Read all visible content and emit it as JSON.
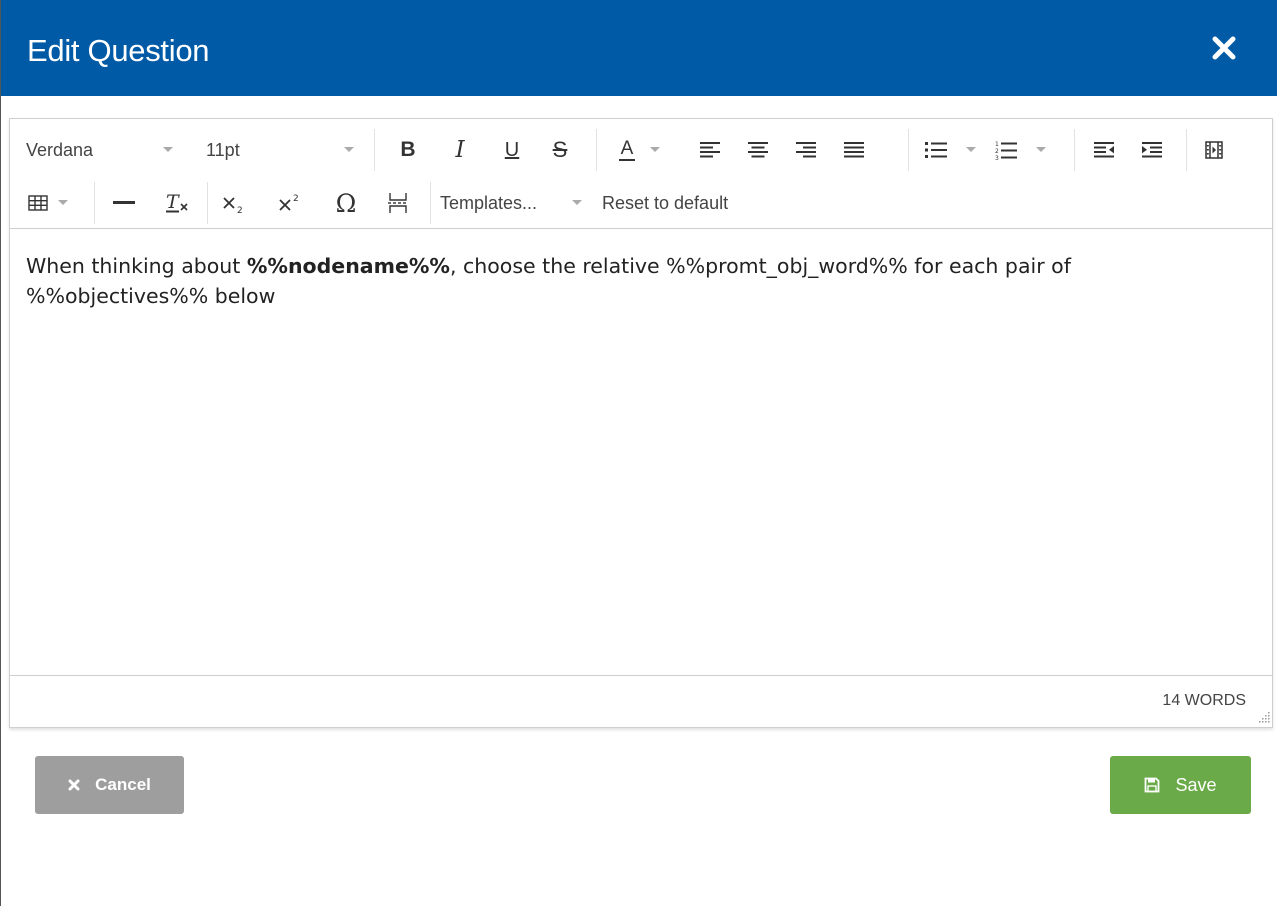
{
  "dialog": {
    "title": "Edit Question"
  },
  "toolbar": {
    "font_family": "Verdana",
    "font_size": "11pt",
    "bold": "B",
    "italic": "I",
    "underline": "U",
    "strikethrough": "S",
    "text_color": "A",
    "templates": "Templates...",
    "reset": "Reset to default",
    "omega": "Ω"
  },
  "editor": {
    "text_before": "When thinking about ",
    "text_bold": "%%nodename%%",
    "text_after": ", choose the relative %%promt_obj_word%% for each pair of %%objectives%% below",
    "word_count": "14 WORDS"
  },
  "footer": {
    "cancel_label": "Cancel",
    "save_label": "Save"
  },
  "colors": {
    "header": "#005aa6",
    "save": "#6aaa49",
    "cancel": "#9e9e9e"
  }
}
